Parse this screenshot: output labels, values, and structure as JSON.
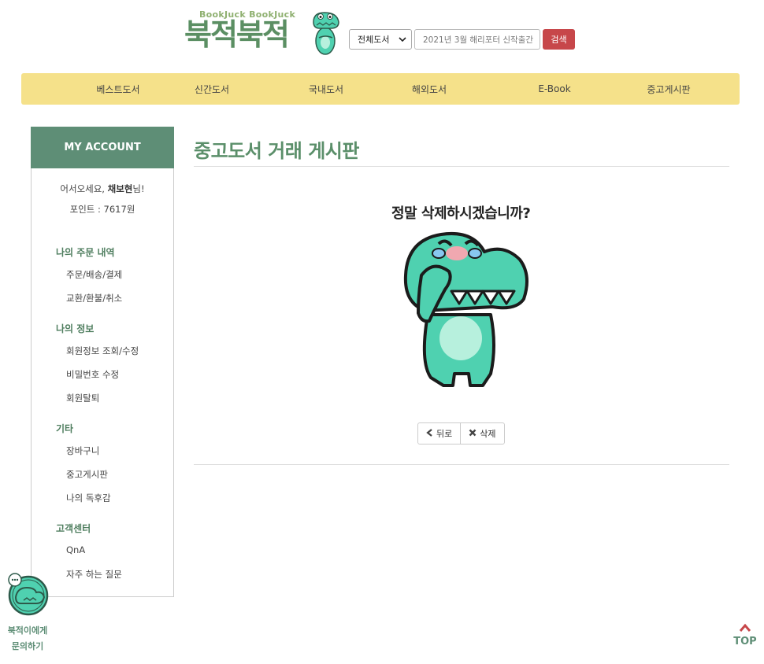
{
  "header": {
    "logo_sub": "BookJuck BookJuck",
    "logo_main": "북적북적",
    "search_category": "전체도서",
    "search_placeholder": "2021년 3월 해리포터 신작출간",
    "search_button": "검색"
  },
  "nav": {
    "items": [
      "베스트도서",
      "신간도서",
      "국내도서",
      "해외도서",
      "E-Book",
      "중고게시판"
    ]
  },
  "sidebar": {
    "title": "MY ACCOUNT",
    "greeting_prefix": "어서오세요, ",
    "user_name": "채보현",
    "greeting_suffix": "님!",
    "points": "포인트 : 7617원",
    "sections": [
      {
        "title": "나의 주문 내역",
        "items": [
          "주문/배송/결제",
          "교환/환불/취소"
        ]
      },
      {
        "title": "나의 정보",
        "items": [
          "회원정보 조회/수정",
          "비밀번호 수정",
          "회원탈퇴"
        ]
      },
      {
        "title": "기타",
        "items": [
          "장바구니",
          "중고게시판",
          "나의 독후감"
        ]
      },
      {
        "title": "고객센터",
        "items": [
          "QnA",
          "자주 하는 질문"
        ]
      }
    ]
  },
  "main": {
    "title": "중고도서 거래 게시판",
    "question": "정말 삭제하시겠습니까?",
    "back_button": "뒤로",
    "delete_button": "삭제"
  },
  "floating": {
    "chat_line1": "북적이에게",
    "chat_line2": "문의하기",
    "top": "TOP"
  },
  "colors": {
    "nav_bg": "#f5e18a",
    "sidebar_head": "#5e8e76",
    "accent_red": "#c7474a",
    "title_green": "#5b8f6a",
    "dino": "#4fd1b0"
  }
}
